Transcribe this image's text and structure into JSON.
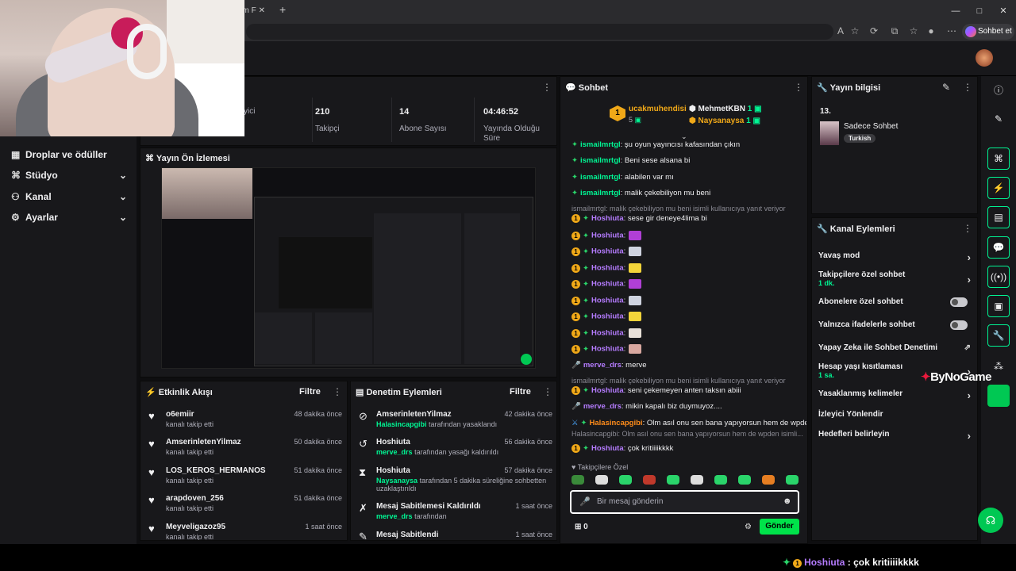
{
  "browser": {
    "tab_label": "üm F",
    "sohbet_label": "Sohbet et"
  },
  "nav": {
    "items": [
      {
        "label": "Droplar ve ödüller",
        "icon": "drops-icon"
      },
      {
        "label": "Stüdyo",
        "icon": "studio-icon"
      },
      {
        "label": "Kanal",
        "icon": "channel-icon"
      },
      {
        "label": "Ayarlar",
        "icon": "settings-icon"
      }
    ]
  },
  "stats": {
    "items": [
      {
        "value": "",
        "label": "yici"
      },
      {
        "value": "210",
        "label": "Takipçi"
      },
      {
        "value": "14",
        "label": "Abone Sayısı"
      },
      {
        "value": "04:46:52",
        "label": "Yayında Olduğu Süre"
      }
    ]
  },
  "preview": {
    "title": "Yayın Ön İzlemesi"
  },
  "events": {
    "title": "Etkinlik Akışı",
    "filter": "Filtre",
    "items": [
      {
        "name": "o6emiir",
        "sub": "kanalı takip etti",
        "time": "48 dakika önce"
      },
      {
        "name": "AmserinletenYilmaz",
        "sub": "kanalı takip etti",
        "time": "50 dakika önce"
      },
      {
        "name": "LOS_KEROS_HERMANOS",
        "sub": "kanalı takip etti",
        "time": "51 dakika önce"
      },
      {
        "name": "arapdoven_256",
        "sub": "kanalı takip etti",
        "time": "51 dakika önce"
      },
      {
        "name": "Meyveligazoz95",
        "sub": "kanalı takip etti",
        "time": "1 saat önce"
      }
    ]
  },
  "modlog": {
    "title": "Denetim Eylemleri",
    "filter": "Filtre",
    "items": [
      {
        "name": "AmserinletenYilmaz",
        "actor": "Halasincapgibi",
        "sub": "tarafından yasaklandı",
        "time": "42 dakika önce",
        "icon": "ban-icon"
      },
      {
        "name": "Hoshiuta",
        "actor": "merve_drs",
        "sub": "tarafından yasağı kaldırıldı",
        "time": "56 dakika önce",
        "icon": "unban-icon"
      },
      {
        "name": "Hoshiuta",
        "actor": "Naysanaysa",
        "sub": "tarafından 5 dakika süreliğine sohbetten uzaklaştırıldı",
        "time": "57 dakika önce",
        "icon": "timeout-icon"
      },
      {
        "name": "Mesaj Sabitlemesi Kaldırıldı",
        "actor": "merve_drs",
        "sub": "tarafından",
        "time": "1 saat önce",
        "icon": "unpin-icon"
      },
      {
        "name": "Mesaj Sabitlendi",
        "actor": "",
        "sub": "",
        "time": "1 saat önce",
        "icon": "pin-icon"
      }
    ]
  },
  "chat": {
    "title": "Sohbet",
    "leaders": [
      {
        "name": "ucakmuhendisi",
        "count": "5"
      },
      {
        "name": "MehmetKBN",
        "count": "1"
      },
      {
        "name": "Naysanaysa",
        "count": "1"
      }
    ],
    "lines": [
      {
        "user": "ismailmrtgl",
        "color": "#00f593",
        "text": ": şu oyun yayıncısı kafasından çıkın",
        "badge": "",
        "reply": ""
      },
      {
        "user": "ismailmrtgl",
        "color": "#00f593",
        "text": ": Beni sese alsana bi",
        "badge": "",
        "reply": ""
      },
      {
        "user": "ismailmrtgl",
        "color": "#00f593",
        "text": ": alabilen var mı",
        "badge": "",
        "reply": ""
      },
      {
        "user": "ismailmrtgl",
        "color": "#00f593",
        "text": ": malik çekebiliyon mu beni",
        "badge": "",
        "reply": ""
      },
      {
        "user": "",
        "color": "",
        "text": "",
        "badge": "",
        "reply": "ismailmrtgl: malik çekebiliyon mu beni isimli kullanıcıya yanıt veriyor"
      },
      {
        "user": "Hoshiuta",
        "color": "#b57cff",
        "text": ": sese gir deneye4lima bi",
        "badge": "1",
        "reply": ""
      },
      {
        "user": "Hoshiuta",
        "color": "#b57cff",
        "text": ":",
        "badge": "1",
        "reply": "",
        "emote": "#b03fd6"
      },
      {
        "user": "Hoshiuta",
        "color": "#b57cff",
        "text": ":",
        "badge": "1",
        "reply": "",
        "emote": "#cfd3e0"
      },
      {
        "user": "Hoshiuta",
        "color": "#b57cff",
        "text": ":",
        "badge": "1",
        "reply": "",
        "emote": "#f2d43a"
      },
      {
        "user": "Hoshiuta",
        "color": "#b57cff",
        "text": ":",
        "badge": "1",
        "reply": "",
        "emote": "#b03fd6"
      },
      {
        "user": "Hoshiuta",
        "color": "#b57cff",
        "text": ":",
        "badge": "1",
        "reply": "",
        "emote": "#cfd3e0"
      },
      {
        "user": "Hoshiuta",
        "color": "#b57cff",
        "text": ":",
        "badge": "1",
        "reply": "",
        "emote": "#f2d43a"
      },
      {
        "user": "Hoshiuta",
        "color": "#b57cff",
        "text": ":",
        "badge": "1",
        "reply": "",
        "emote": "#e8e0d8"
      },
      {
        "user": "Hoshiuta",
        "color": "#b57cff",
        "text": ":",
        "badge": "1",
        "reply": "",
        "emote": "#d9a8a0"
      },
      {
        "user": "merve_drs",
        "color": "#b57cff",
        "text": ": merve",
        "badge": "mic",
        "reply": ""
      },
      {
        "user": "",
        "color": "",
        "text": "",
        "badge": "",
        "reply": "ismailmrtgl: malik çekebiliyon mu beni isimli kullanıcıya yanıt veriyor"
      },
      {
        "user": "Hoshiuta",
        "color": "#b57cff",
        "text": ": seni çekemeyen anten taksın abiii",
        "badge": "1",
        "reply": ""
      },
      {
        "user": "merve_drs",
        "color": "#b57cff",
        "text": ": mikin kapalı biz duymuyoz....",
        "badge": "mic",
        "reply": ""
      },
      {
        "user": "Halasincapgibi",
        "color": "#ff8c1a",
        "text": ": Olm asıl onu sen bana yapıyorsun hem de wpden",
        "badge": "sword",
        "reply": ""
      },
      {
        "user": "",
        "color": "",
        "text": "",
        "badge": "",
        "reply": "Halasincapgibi: Olm asıl onu sen bana yapıyorsun hem de wpden isimli..."
      },
      {
        "user": "Hoshiuta",
        "color": "#b57cff",
        "text": ": çok kritiiiikkkk",
        "badge": "1",
        "reply": ""
      }
    ],
    "followers_only": "Takipçilere Özel",
    "input_placeholder": "Bir mesaj gönderin",
    "points": "0",
    "send": "Gönder"
  },
  "stream_info": {
    "title": "Yayın bilgisi",
    "number": "13.",
    "stream_title": "Sadece Sohbet",
    "tag": "Turkish"
  },
  "channel_actions": {
    "title": "Kanal Eylemleri",
    "items": [
      {
        "label": "Yavaş mod",
        "sub": "",
        "type": "arrow"
      },
      {
        "label": "Takipçilere özel sohbet",
        "sub": "1 dk.",
        "type": "arrow"
      },
      {
        "label": "Abonelere özel sohbet",
        "sub": "",
        "type": "toggle"
      },
      {
        "label": "Yalnızca ifadelerle sohbet",
        "sub": "",
        "type": "toggle"
      },
      {
        "label": "Yapay Zeka ile Sohbet Denetimi",
        "sub": "",
        "type": "external"
      },
      {
        "label": "Hesap yaşı kısıtlaması",
        "sub": "1 sa.",
        "type": "arrow"
      },
      {
        "label": "Yasaklanmış kelimeler",
        "sub": "",
        "type": "arrow"
      },
      {
        "label": "İzleyici Yönlendir",
        "sub": "",
        "type": "none"
      },
      {
        "label": "Hedefleri belirleyin",
        "sub": "",
        "type": "arrow"
      }
    ]
  },
  "overlay": {
    "bynogame": "ByNoGame",
    "message_user": "Hoshiuta",
    "message_text": " : çok kritiiiikkkk",
    "badge": "1"
  },
  "colors": {
    "accent": "#00f593",
    "send": "#00e24a",
    "gold": "#f0a818",
    "purple": "#b57cff"
  }
}
